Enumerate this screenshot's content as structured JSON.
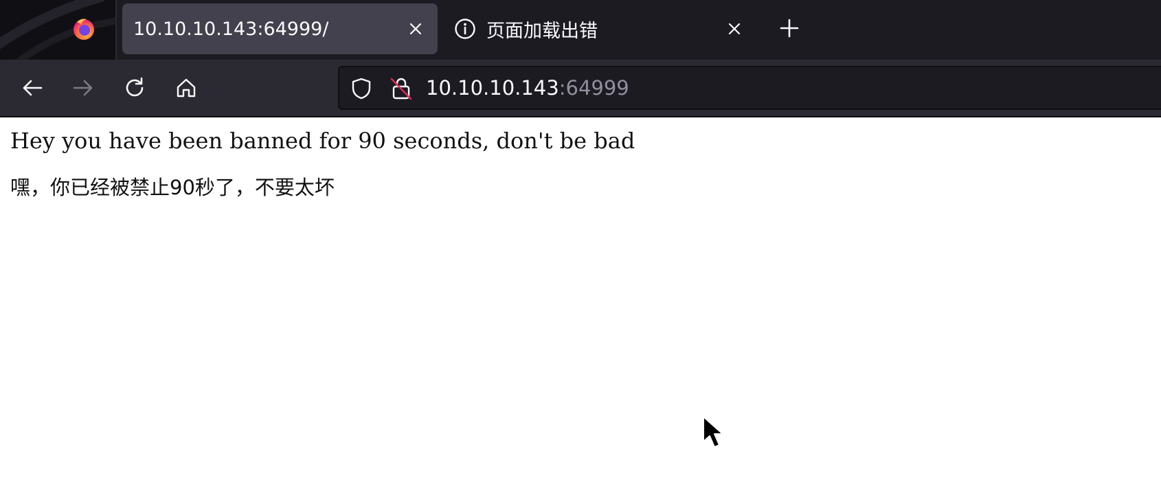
{
  "tabs": [
    {
      "title": "10.10.10.143:64999/",
      "active": true,
      "close_icon": "close-icon"
    },
    {
      "title": "页面加载出错",
      "active": false,
      "icon": "info-icon",
      "close_icon": "close-icon"
    }
  ],
  "new_tab_icon": "plus-icon",
  "toolbar": {
    "back_icon": "back-arrow-icon",
    "forward_icon": "forward-arrow-icon",
    "reload_icon": "reload-icon",
    "home_icon": "home-icon"
  },
  "address_bar": {
    "host": "10.10.10.143",
    "port": ":64999",
    "shield_icon": "tracking-protection-shield-icon",
    "lock_icon": "insecure-lock-icon"
  },
  "page": {
    "message_en": "Hey you have been banned for 90 seconds, don't be bad",
    "message_zh": "嘿，你已经被禁止90秒了，不要太坏"
  },
  "colors": {
    "tabbar_bg": "#1c1b22",
    "active_tab_bg": "#42414d",
    "toolbar_bg": "#2b2a33",
    "urlbar_bg": "#1c1b22",
    "text_light": "#fbfbfe",
    "text_muted": "#8f8f9d",
    "insecure_red": "#e22850",
    "page_bg": "#ffffff"
  }
}
